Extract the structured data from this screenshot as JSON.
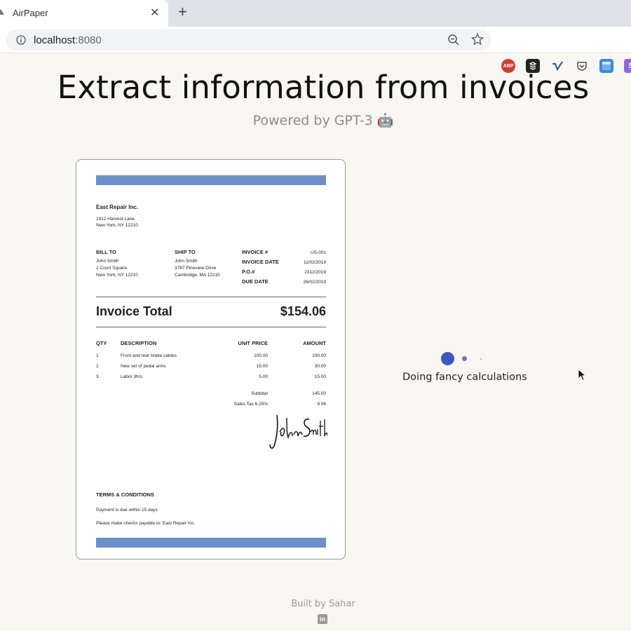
{
  "browser": {
    "tab_title": "AirPaper",
    "tab_close": "✕",
    "new_tab": "+",
    "url_host": "localhost",
    "url_port": ":8080",
    "extensions": [
      "ABP",
      "",
      "",
      "",
      "",
      "S"
    ]
  },
  "page": {
    "headline": "Extract information from invoices",
    "subtitle": "Powered by GPT-3 🤖",
    "loader_text": "Doing fancy calculations",
    "footer": "Built by Sahar",
    "linkedin": "in"
  },
  "invoice": {
    "company": "East Repair Inc.",
    "company_addr1": "1912 Harvest Lane",
    "company_addr2": "New York, NY 12210",
    "bill_to_label": "BILL TO",
    "bill_to": [
      "John Smith",
      "2 Court Square",
      "New York, NY 12210"
    ],
    "ship_to_label": "SHIP TO",
    "ship_to": [
      "John Smith",
      "3787 Pineview Drive",
      "Cambridge, MA 12210"
    ],
    "meta": [
      {
        "label": "INVOICE #",
        "value": "US-001"
      },
      {
        "label": "INVOICE DATE",
        "value": "11/02/2019"
      },
      {
        "label": "P.O.#",
        "value": "2312/2019"
      },
      {
        "label": "DUE DATE",
        "value": "26/02/2019"
      }
    ],
    "total_label": "Invoice Total",
    "total_value": "$154.06",
    "columns": [
      "QTY",
      "DESCRIPTION",
      "UNIT PRICE",
      "AMOUNT"
    ],
    "items": [
      {
        "qty": "1",
        "desc": "Front and rear brake cables",
        "unit": "100.00",
        "amount": "100.00"
      },
      {
        "qty": "2",
        "desc": "New set of pedal arms",
        "unit": "15.00",
        "amount": "30.00"
      },
      {
        "qty": "3",
        "desc": "Labor 3hrs",
        "unit": "5.00",
        "amount": "15.00"
      }
    ],
    "subtotal_label": "Subtotal",
    "subtotal_value": "145.00",
    "tax_label": "Sales Tax 6.25%",
    "tax_value": "9.06",
    "signature": "John Smith",
    "terms_label": "TERMS & CONDITIONS",
    "terms": [
      "Payment is due within 15 days",
      "Please make checks payable to: East Repair Inc."
    ],
    "accent_color": "#6d8fc9"
  }
}
